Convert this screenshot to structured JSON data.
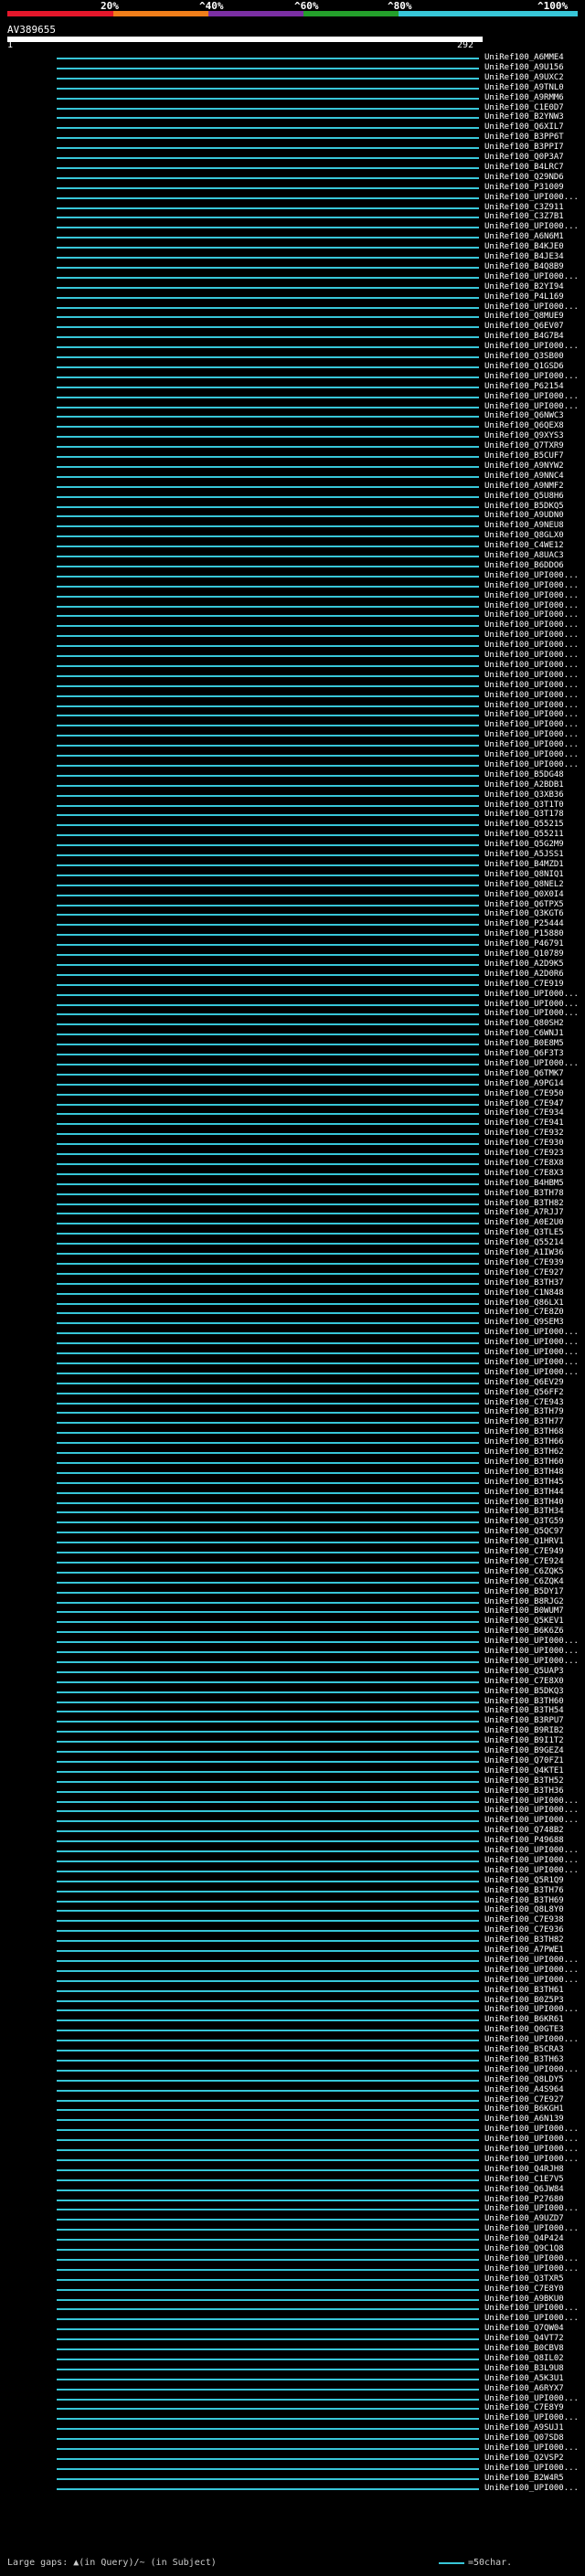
{
  "scale": {
    "labels": [
      "20%",
      "^40%",
      "^60%",
      "^80%",
      "^100%"
    ],
    "colors": [
      "#e5172b",
      "#f07e1a",
      "#7b2fa3",
      "#24a02b",
      "#37c6d8"
    ]
  },
  "query": {
    "id": "AV389655",
    "start": "1",
    "end": "292"
  },
  "hits": [
    "UniRef100_A6MME4",
    "UniRef100_A9U156",
    "UniRef100_A9UXC2",
    "UniRef100_A9TNL0",
    "UniRef100_A9RMM6",
    "UniRef100_C1E0D7",
    "UniRef100_B2YNW3",
    "UniRef100_Q6XIL7",
    "UniRef100_B3PP6T",
    "UniRef100_B3PPI7",
    "UniRef100_Q0P3A7",
    "UniRef100_B4LRC7",
    "UniRef100_Q29ND6",
    "UniRef100_P31009",
    "UniRef100_UPI000...",
    "UniRef100_C3Z911",
    "UniRef100_C3Z7B1",
    "UniRef100_UPI000...",
    "UniRef100_A6N6M1",
    "UniRef100_B4KJE0",
    "UniRef100_B4JE34",
    "UniRef100_B4Q8B9",
    "UniRef100_UPI000...",
    "UniRef100_B2YI94",
    "UniRef100_P4L169",
    "UniRef100_UPI000...",
    "UniRef100_Q8MUE9",
    "UniRef100_Q6EV07",
    "UniRef100_B4G7B4",
    "UniRef100_UPI000...",
    "UniRef100_Q3SB00",
    "UniRef100_Q1GSD6",
    "UniRef100_UPI000...",
    "UniRef100_P62154",
    "UniRef100_UPI000...",
    "UniRef100_UPI000...",
    "UniRef100_Q6NWC3",
    "UniRef100_Q6QEX8",
    "UniRef100_Q9XYS3",
    "UniRef100_Q7TXR9",
    "UniRef100_B5CUF7",
    "UniRef100_A9NYW2",
    "UniRef100_A9NNC4",
    "UniRef100_A9NMF2",
    "UniRef100_Q5U8H6",
    "UniRef100_B5DKQ5",
    "UniRef100_A9UDN0",
    "UniRef100_A9NEU8",
    "UniRef100_Q8GLX0",
    "UniRef100_C4WE12",
    "UniRef100_A8UAC3",
    "UniRef100_B6DDO6",
    "UniRef100_UPI000...",
    "UniRef100_UPI000...",
    "UniRef100_UPI000...",
    "UniRef100_UPI000...",
    "UniRef100_UPI000...",
    "UniRef100_UPI000...",
    "UniRef100_UPI000...",
    "UniRef100_UPI000...",
    "UniRef100_UPI000...",
    "UniRef100_UPI000...",
    "UniRef100_UPI000...",
    "UniRef100_UPI000...",
    "UniRef100_UPI000...",
    "UniRef100_UPI000...",
    "UniRef100_UPI000...",
    "UniRef100_UPI000...",
    "UniRef100_UPI000...",
    "UniRef100_UPI000...",
    "UniRef100_UPI000...",
    "UniRef100_UPI000...",
    "UniRef100_B5DG48",
    "UniRef100_A2BDB1",
    "UniRef100_Q3XB36",
    "UniRef100_Q3T1T0",
    "UniRef100_Q3T178",
    "UniRef100_Q55215",
    "UniRef100_Q55211",
    "UniRef100_Q5G2M9",
    "UniRef100_A5JSS1",
    "UniRef100_B4MZD1",
    "UniRef100_Q8NIQ1",
    "UniRef100_Q8NEL2",
    "UniRef100_Q0X0I4",
    "UniRef100_Q6TPX5",
    "UniRef100_Q3KGT6",
    "UniRef100_P25444",
    "UniRef100_P15880",
    "UniRef100_P46791",
    "UniRef100_Q10789",
    "UniRef100_A2D9K5",
    "UniRef100_A2D0R6",
    "UniRef100_C7E919",
    "UniRef100_UPI000...",
    "UniRef100_UPI000...",
    "UniRef100_UPI000...",
    "UniRef100_Q80SH2",
    "UniRef100_C6WNJ1",
    "UniRef100_B0E8M5",
    "UniRef100_Q6F3T3",
    "UniRef100_UPI000...",
    "UniRef100_Q6TMK7",
    "UniRef100_A9PG14",
    "UniRef100_C7E950",
    "UniRef100_C7E947",
    "UniRef100_C7E934",
    "UniRef100_C7E941",
    "UniRef100_C7E932",
    "UniRef100_C7E930",
    "UniRef100_C7E923",
    "UniRef100_C7E8X8",
    "UniRef100_C7E8X3",
    "UniRef100_B4HBM5",
    "UniRef100_B3TH78",
    "UniRef100_B3TH82",
    "UniRef100_A7RJJ7",
    "UniRef100_A0E2U0",
    "UniRef100_Q3TLE5",
    "UniRef100_Q55214",
    "UniRef100_A1IW36",
    "UniRef100_C7E939",
    "UniRef100_C7E927",
    "UniRef100_B3TH37",
    "UniRef100_C1N848",
    "UniRef100_Q86LX1",
    "UniRef100_C7E8Z0",
    "UniRef100_Q9SEM3",
    "UniRef100_UPI000...",
    "UniRef100_UPI000...",
    "UniRef100_UPI000...",
    "UniRef100_UPI000...",
    "UniRef100_UPI000...",
    "UniRef100_Q6EV29",
    "UniRef100_Q56FF2",
    "UniRef100_C7E943",
    "UniRef100_B3TH79",
    "UniRef100_B3TH77",
    "UniRef100_B3TH68",
    "UniRef100_B3TH66",
    "UniRef100_B3TH62",
    "UniRef100_B3TH60",
    "UniRef100_B3TH48",
    "UniRef100_B3TH45",
    "UniRef100_B3TH44",
    "UniRef100_B3TH40",
    "UniRef100_B3TH34",
    "UniRef100_Q3TG59",
    "UniRef100_Q5QC97",
    "UniRef100_Q1HRV1",
    "UniRef100_C7E949",
    "UniRef100_C7E924",
    "UniRef100_C6ZQK5",
    "UniRef100_C6ZQK4",
    "UniRef100_B5DY17",
    "UniRef100_B8RJG2",
    "UniRef100_B0WUM7",
    "UniRef100_Q5KEV1",
    "UniRef100_B6K6Z6",
    "UniRef100_UPI000...",
    "UniRef100_UPI000...",
    "UniRef100_UPI000...",
    "UniRef100_Q5UAP3",
    "UniRef100_C7E8X0",
    "UniRef100_B5DKQ3",
    "UniRef100_B3TH60",
    "UniRef100_B3TH54",
    "UniRef100_B3RPU7",
    "UniRef100_B9RIB2",
    "UniRef100_B9I1T2",
    "UniRef100_B9GEZ4",
    "UniRef100_Q70FZ1",
    "UniRef100_Q4KTE1",
    "UniRef100_B3TH52",
    "UniRef100_B3TH36",
    "UniRef100_UPI000...",
    "UniRef100_UPI000...",
    "UniRef100_UPI000...",
    "UniRef100_Q748B2",
    "UniRef100_P49688",
    "UniRef100_UPI000...",
    "UniRef100_UPI000...",
    "UniRef100_UPI000...",
    "UniRef100_Q5R1Q9",
    "UniRef100_B3TH76",
    "UniRef100_B3TH69",
    "UniRef100_Q8L8Y0",
    "UniRef100_C7E938",
    "UniRef100_C7E936",
    "UniRef100_B3TH82",
    "UniRef100_A7PWE1",
    "UniRef100_UPI000...",
    "UniRef100_UPI000...",
    "UniRef100_UPI000...",
    "UniRef100_B3TH61",
    "UniRef100_B0Z5P3",
    "UniRef100_UPI000...",
    "UniRef100_B6KR61",
    "UniRef100_Q0GTE3",
    "UniRef100_UPI000...",
    "UniRef100_B5CRA3",
    "UniRef100_B3TH63",
    "UniRef100_UPI000...",
    "UniRef100_Q8LDY5",
    "UniRef100_A4S964",
    "UniRef100_C7E927",
    "UniRef100_B6KGH1",
    "UniRef100_A6N139",
    "UniRef100_UPI000...",
    "UniRef100_UPI000...",
    "UniRef100_UPI000...",
    "UniRef100_UPI000...",
    "UniRef100_Q4RJH8",
    "UniRef100_C1E7V5",
    "UniRef100_Q6JW84",
    "UniRef100_P27680",
    "UniRef100_UPI000...",
    "UniRef100_A9UZD7",
    "UniRef100_UPI000...",
    "UniRef100_Q4P424",
    "UniRef100_Q9C1Q8",
    "UniRef100_UPI000...",
    "UniRef100_UPI000...",
    "UniRef100_Q3TXR5",
    "UniRef100_C7E8Y0",
    "UniRef100_A9BKU0",
    "UniRef100_UPI000...",
    "UniRef100_UPI000...",
    "UniRef100_Q7QW04",
    "UniRef100_Q4VT72",
    "UniRef100_B0CBV8",
    "UniRef100_Q8IL02",
    "UniRef100_B3L9U8",
    "UniRef100_A5K3U1",
    "UniRef100_A6RYX7",
    "UniRef100_UPI000...",
    "UniRef100_C7E8Y9",
    "UniRef100_UPI000...",
    "UniRef100_A9SUJ1",
    "UniRef100_Q07SD8",
    "UniRef100_UPI000...",
    "UniRef100_Q2VSP2",
    "UniRef100_UPI000...",
    "UniRef100_B2W4R5",
    "UniRef100_UPI000..."
  ],
  "footer": {
    "text": "Large gaps: ▲(in Query)/~ (in Subject)",
    "legend": "=50char."
  }
}
